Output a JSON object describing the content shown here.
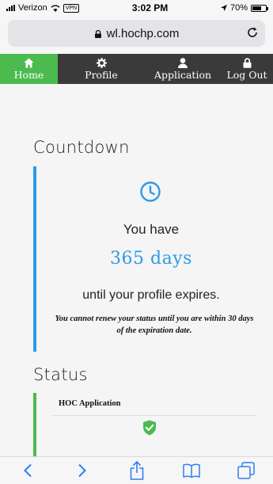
{
  "status_bar": {
    "carrier": "Verizon",
    "vpn": "VPN",
    "time": "3:02 PM",
    "battery": "70%",
    "battery_level": 0.7
  },
  "browser": {
    "url": "wl.hochp.com"
  },
  "nav": {
    "items": [
      {
        "label": "Home",
        "icon": "home-icon",
        "active": true
      },
      {
        "label": "Profile",
        "icon": "gear-icon"
      },
      {
        "label": "Application",
        "icon": "person-icon"
      },
      {
        "label": "Log Out",
        "icon": "lock-icon"
      }
    ]
  },
  "countdown": {
    "title": "Countdown",
    "you_have": "You have",
    "days": "365 days",
    "until": "until your profile expires.",
    "note": "You cannot renew your status until you are within 30 days of the expiration date."
  },
  "status": {
    "title": "Status",
    "item_label": "HOC Application"
  },
  "colors": {
    "accent_blue": "#2c9ce6",
    "accent_green": "#4cbb4f",
    "nav_dark": "#3a3a3a"
  }
}
